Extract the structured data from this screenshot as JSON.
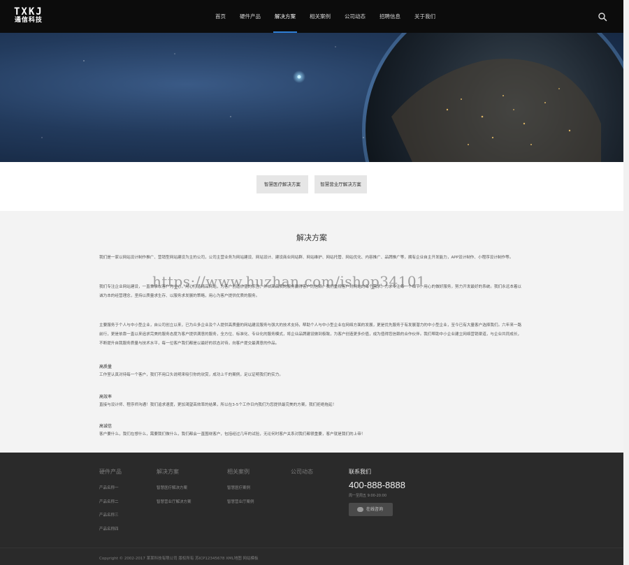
{
  "header": {
    "logo_main": "TXKJ",
    "logo_sub": "通信科技",
    "nav": [
      "首页",
      "硬件产品",
      "解决方案",
      "相关案例",
      "公司动态",
      "招聘信息",
      "关于我们"
    ],
    "active_nav": "解决方案",
    "search_icon": "search-icon"
  },
  "tabs": [
    "智慧医疗解决方案",
    "智慧营业厅解决方案"
  ],
  "content": {
    "title": "解决方案",
    "paragraphs": [
      "我们是一家以网站设计制作推广、营销型网站建设为主的公司，公司主营业务为网站建设、网站设计、建设商业网站群、网站维护、网站托管、网站优化、内容推广、品牌推广等，拥有企业自主开发能力，APP设计制作、小程序设计制作等。",
      "我们专注企业网站建设，一直秉承以客户为中心，用心打造精品网站，为客户创造价值的宗旨，并以高品质的服务赢得客户的信赖。我们重视客户对网站的每个需求，力求专注每一个细节，用心的做好服务，努力开发最好的系统。我们永远本着以诚为本的经营理念，坚持以质量求生存、以服务求发展的策略，用心为客户提供优质的服务。",
      "主要服务于个人与中小型企业，自公司创立以来，已为众多企业及个人提供高质量的网站建设服务与强大的技术支持，帮助个人与中小型企业在网络方面的发展，更是优先服务于有发展潜力的中小型企业，至今已有大量客户选择我们。六年来一路前行，更是依靠一直以来追求完美的服务态度为客户提供满意的服务，全方位、标准化、专业化的服务模式，将企业品牌建设做到极致，为客户创造更多价值，成为值得您信赖的合作伙伴。我们帮助中小企业建立网络营销渠道，与企业共同成长，不断提升自我服务质量与技术水平，每一位客户我们都是以最好的状态对待，向客户提交最满意的作品。"
    ],
    "features": [
      {
        "title": "高质量",
        "text": "工作室认真对待每一个客户，我们不用口头说明来吸引你的欣赏，成功上千的案例，足以证明我们的实力。"
      },
      {
        "title": "高效率",
        "text": "直接与设计师、程序师沟通！我们追求速度，更加渴望高效率的结果，所以在3-5个工作日内我们为您提供最完美的方案，我们拒绝拖延！"
      },
      {
        "title": "高诚信",
        "text": "客户要什么，我们在想什么，需要我们做什么，我们都会一直围绕客户，包括经过几年的试验，无论何时客户关系对我们都很重要，客户就是我们的上帝！"
      }
    ],
    "watermark": "https://www.huzhan.com/ishop34101"
  },
  "footer": {
    "columns": [
      {
        "title": "硬件产品",
        "links": [
          "产品名称一",
          "产品名称二",
          "产品名称三",
          "产品名称四"
        ]
      },
      {
        "title": "解决方案",
        "links": [
          "智慧医疗解决方案",
          "智慧营业厅解决方案"
        ]
      },
      {
        "title": "相关案例",
        "links": [
          "智慧医疗案例",
          "智慧营业厅案例"
        ]
      },
      {
        "title": "公司动态",
        "links": []
      }
    ],
    "contact_title": "联系我们",
    "phone": "400-888-8888",
    "hours": "周一至周五 9:00-20:00",
    "consult_label": "在线咨询",
    "copyright": "Copyright © 2002-2017 某某科技有限公司 版权所有  苏ICP12345678  XML地图  网站模板"
  },
  "colors": {
    "header_bg": "#0c0c0c",
    "active_underline": "#2f7fd6",
    "content_bg": "#f3f3f3",
    "footer_bg": "#2a2a2a"
  }
}
